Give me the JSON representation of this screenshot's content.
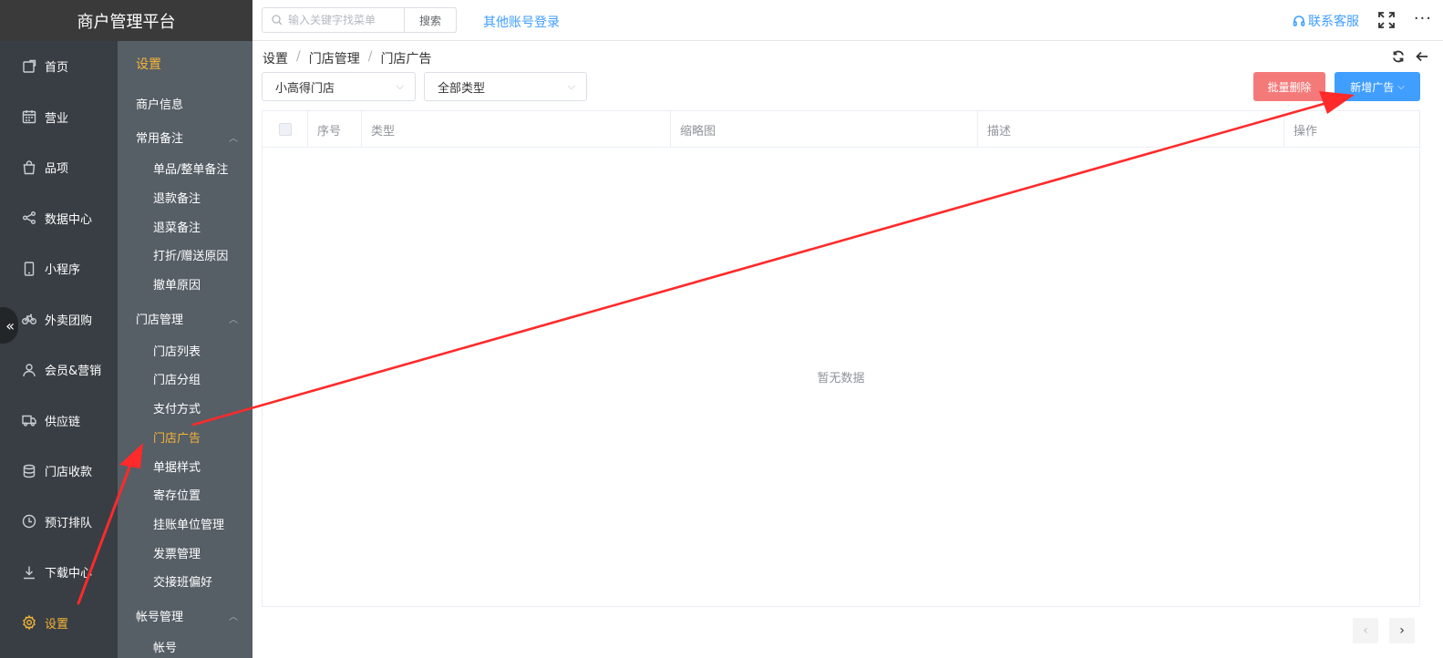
{
  "app": {
    "title": "商户管理平台",
    "collapse_glyph": "«"
  },
  "main_nav": [
    {
      "label": "首页",
      "icon": "home-icon",
      "active": false
    },
    {
      "label": "营业",
      "icon": "calendar-icon",
      "active": false
    },
    {
      "label": "品项",
      "icon": "bag-icon",
      "active": false
    },
    {
      "label": "数据中心",
      "icon": "share-icon",
      "active": false
    },
    {
      "label": "小程序",
      "icon": "mobile-icon",
      "active": false
    },
    {
      "label": "外卖团购",
      "icon": "bicycle-icon",
      "active": false
    },
    {
      "label": "会员&营销",
      "icon": "user-icon",
      "active": false
    },
    {
      "label": "供应链",
      "icon": "truck-icon",
      "active": false
    },
    {
      "label": "门店收款",
      "icon": "database-icon",
      "active": false
    },
    {
      "label": "预订排队",
      "icon": "clock-icon",
      "active": false
    },
    {
      "label": "下载中心",
      "icon": "download-icon",
      "active": false
    },
    {
      "label": "设置",
      "icon": "gear-icon",
      "active": true
    }
  ],
  "sub_nav": {
    "title": "设置",
    "merchant_info": "商户信息",
    "groups": {
      "common_notes": {
        "label": "常用备注",
        "items": [
          "单品/整单备注",
          "退款备注",
          "退菜备注",
          "打折/赠送原因",
          "撤单原因"
        ]
      },
      "store_mgmt": {
        "label": "门店管理",
        "items": [
          "门店列表",
          "门店分组",
          "支付方式",
          "门店广告",
          "单据样式",
          "寄存位置",
          "挂账单位管理",
          "发票管理",
          "交接班偏好"
        ]
      },
      "account_mgmt": {
        "label": "帐号管理",
        "items": [
          "帐号"
        ]
      }
    },
    "chevron_glyph": "︿"
  },
  "topbar": {
    "search_placeholder": "输入关键字找菜单",
    "search_button": "搜索",
    "other_login": "其他账号登录",
    "support": "联系客服",
    "more_glyph": "···"
  },
  "breadcrumb": [
    "设置",
    "门店管理",
    "门店广告"
  ],
  "breadcrumb_sep": "/",
  "filters": {
    "store": "小高得门店",
    "type": "全部类型",
    "caret": "⌵"
  },
  "actions": {
    "batch_delete": "批量删除",
    "add_ad": "新增广告",
    "add_caret": "⌵"
  },
  "table": {
    "columns": [
      "序号",
      "类型",
      "缩略图",
      "描述",
      "操作"
    ],
    "rows": [],
    "empty_text": "暂无数据"
  },
  "pagination": {
    "prev": "‹",
    "next": "›"
  },
  "colors": {
    "accent": "#f5b437",
    "primary": "#409eff",
    "danger": "#f47a7a",
    "annotation": "#ff2a2a"
  }
}
